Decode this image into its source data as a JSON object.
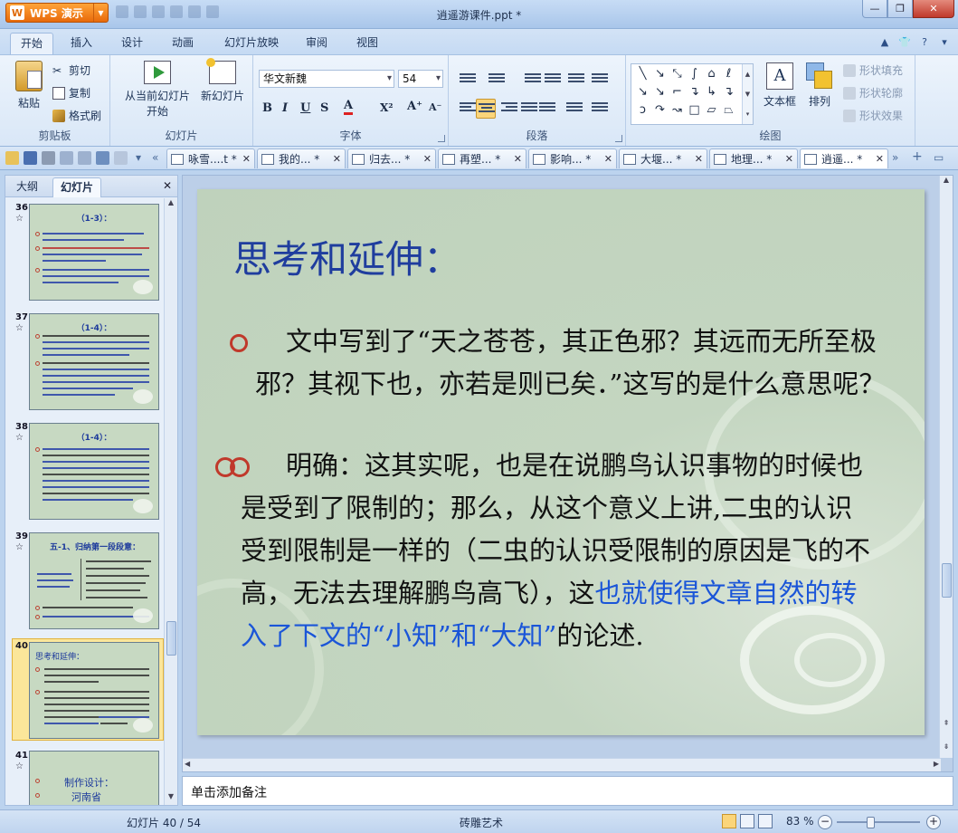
{
  "app": {
    "brand": "WPS 演示",
    "window_title": "逍遥游课件.ppt *"
  },
  "menu": {
    "tabs": [
      "开始",
      "插入",
      "设计",
      "动画",
      "幻灯片放映",
      "审阅",
      "视图"
    ]
  },
  "ribbon": {
    "clipboard": {
      "paste": "粘贴",
      "cut": "剪切",
      "copy": "复制",
      "format_painter": "格式刷",
      "group": "剪贴板"
    },
    "slides": {
      "from_current": "从当前幻灯片",
      "start": "开始",
      "new_slide": "新幻灯片",
      "group": "幻灯片"
    },
    "font": {
      "name": "华文新魏",
      "size": "54",
      "group": "字体"
    },
    "paragraph": {
      "group": "段落"
    },
    "drawing": {
      "textbox": "文本框",
      "arrange": "排列",
      "shape_fill": "形状填充",
      "shape_outline": "形状轮廓",
      "shape_effect": "形状效果",
      "group": "绘图"
    }
  },
  "doc_tabs": [
    "咏雪....t *",
    "我的... *",
    "归去... *",
    "再塑... *",
    "影响... *",
    "大堰... *",
    "地理... *",
    "逍遥... *"
  ],
  "left_panel": {
    "tab_outline": "大纲",
    "tab_slides": "幻灯片",
    "thumbnails": [
      {
        "num": "36",
        "title": "（1-3）："
      },
      {
        "num": "37",
        "title": "（1-4）："
      },
      {
        "num": "38",
        "title": "（1-4）："
      },
      {
        "num": "39",
        "title": "五-1、归纳第一段段意："
      },
      {
        "num": "40",
        "title": "思考和延伸："
      },
      {
        "num": "41",
        "line1": "制作设计：",
        "line2": "河南省"
      }
    ],
    "selected": "40"
  },
  "slide": {
    "title": "思考和延伸：",
    "para1": "文中写到了“天之苍苍，其正色邪？其远而无所至极邪？其视下也，亦若是则已矣．”这写的是什么意思呢？",
    "para2_black": "明确：这其实呢，也是在说鹏鸟认识事物的时候也是受到了限制的；那么，从这个意义上讲,二虫的认识受到限制是一样的（二虫的认识受限制的原因是飞的不高，无法去理解鹏鸟高飞），这",
    "para2_blue": "也就使得文章自然的转入了下文的“小知”和“大知”",
    "para2_end": "的论述."
  },
  "notes": {
    "placeholder": "单击添加备注"
  },
  "status": {
    "position": "幻灯片 40 / 54",
    "theme": "砖雕艺术",
    "zoom": "83 %"
  }
}
